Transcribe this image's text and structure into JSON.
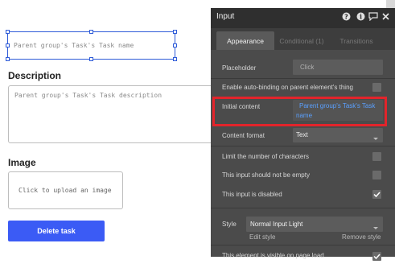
{
  "canvas": {
    "name_input_placeholder": "Parent group's Task's Task name",
    "description_heading": "Description",
    "description_placeholder": "Parent group's Task's Task description",
    "image_heading": "Image",
    "image_upload_text": "Click to upload an image",
    "delete_button_label": "Delete task",
    "delete_button_color": "#3b5bf5"
  },
  "panel": {
    "title": "Input",
    "header_icons": [
      "help-icon",
      "info-icon",
      "comment-icon",
      "close-icon"
    ],
    "tabs": [
      {
        "label": "Appearance",
        "active": true
      },
      {
        "label": "Conditional (1)",
        "active": false
      },
      {
        "label": "Transitions",
        "active": false
      }
    ],
    "placeholder_label": "Placeholder",
    "placeholder_value": "Click",
    "auto_binding_label": "Enable auto-binding on parent element's thing",
    "initial_content_label": "Initial content",
    "initial_content_line1": "Parent group's Task's Task",
    "initial_content_line2": "name",
    "content_format_label": "Content format",
    "content_format_value": "Text",
    "limit_chars_label": "Limit the number of characters",
    "not_empty_label": "This input should not be empty",
    "disabled_label": "This input is disabled",
    "disabled_checked": true,
    "style_label": "Style",
    "style_value": "Normal Input Light",
    "edit_style_label": "Edit style",
    "remove_style_label": "Remove style",
    "visible_on_load_label": "This element is visible on page load",
    "highlight_color": "#e3242b",
    "link_color": "#5aa0ff"
  }
}
